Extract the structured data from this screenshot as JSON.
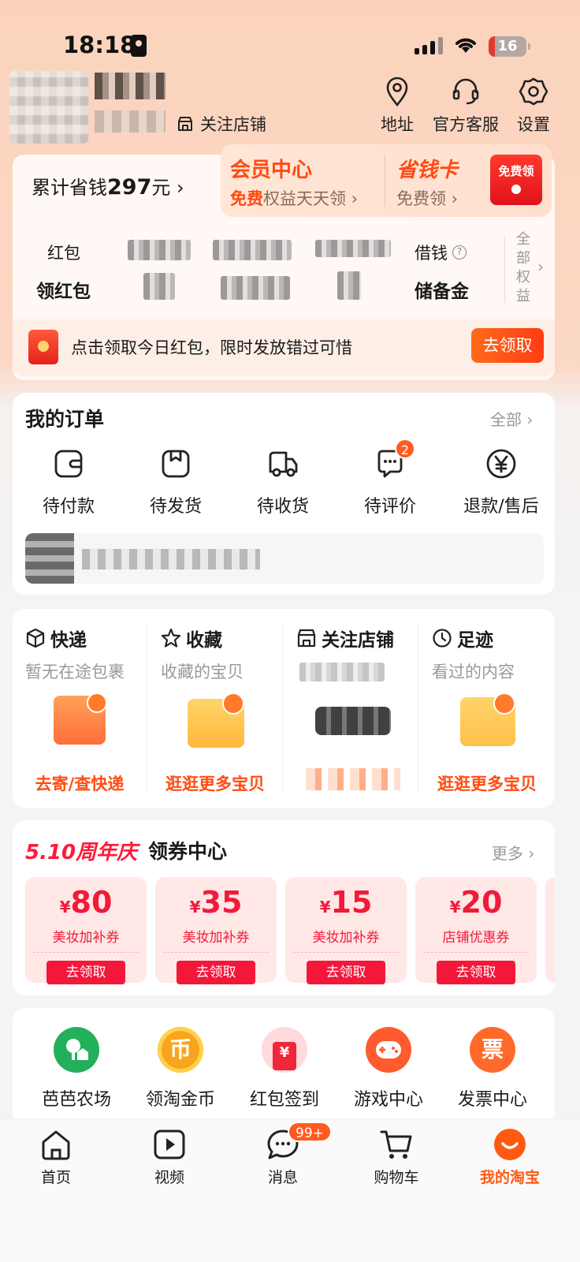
{
  "status_bar": {
    "time": "18:18",
    "battery": "16"
  },
  "profile": {
    "follow_shop": "关注店铺",
    "actions": [
      {
        "label": "地址",
        "icon": "location-pin-icon"
      },
      {
        "label": "官方客服",
        "icon": "headset-icon"
      },
      {
        "label": "设置",
        "icon": "gear-icon"
      }
    ]
  },
  "member": {
    "save_prefix": "累计省钱",
    "save_amount": "297",
    "save_suffix": "元 ›",
    "vip_title": "会员中心",
    "vip_sub_em": "免费",
    "vip_sub_rest": "权益天天领 ›",
    "card_title": "省钱卡",
    "card_sub": "免费领 ›",
    "free_btn": "免费领",
    "row1_label": "红包",
    "row2_label": "领红包",
    "borrow_label": "借钱",
    "reserve_label": "储备金",
    "all_rights": "全部权益",
    "rp_text": "点击领取今日红包，限时发放错过可惜",
    "rp_btn": "去领取"
  },
  "orders": {
    "title": "我的订单",
    "more": "全部 ›",
    "items": [
      {
        "label": "待付款",
        "icon": "wallet-icon"
      },
      {
        "label": "待发货",
        "icon": "package-icon"
      },
      {
        "label": "待收货",
        "icon": "truck-icon"
      },
      {
        "label": "待评价",
        "icon": "comment-icon",
        "badge": "2"
      },
      {
        "label": "退款/售后",
        "icon": "yen-icon"
      }
    ]
  },
  "quick": [
    {
      "title": "快递",
      "sub": "暂无在途包裹",
      "link": "去寄/查快递",
      "icon": "box-icon"
    },
    {
      "title": "收藏",
      "sub": "收藏的宝贝",
      "link": "逛逛更多宝贝",
      "icon": "star-icon"
    },
    {
      "title": "关注店铺",
      "sub": "",
      "link": "",
      "icon": "shop-icon"
    },
    {
      "title": "足迹",
      "sub": "看过的内容",
      "link": "逛逛更多宝贝",
      "icon": "clock-icon"
    }
  ],
  "coupons": {
    "anniv": "5.10周年庆",
    "title": "领券中心",
    "more": "更多 ›",
    "items": [
      {
        "currency": "¥",
        "amount": "80",
        "desc": "美妆加补券",
        "btn": "去领取"
      },
      {
        "currency": "¥",
        "amount": "35",
        "desc": "美妆加补券",
        "btn": "去领取"
      },
      {
        "currency": "¥",
        "amount": "15",
        "desc": "美妆加补券",
        "btn": "去领取"
      },
      {
        "currency": "¥",
        "amount": "20",
        "desc": "店铺优惠券",
        "btn": "去领取"
      }
    ]
  },
  "services": [
    {
      "label": "芭芭农场",
      "glyph": "",
      "color": "#22b05a",
      "icon": "farm-icon"
    },
    {
      "label": "领淘金币",
      "glyph": "币",
      "color": "#f7a51c",
      "icon": "gold-coin-icon"
    },
    {
      "label": "红包签到",
      "glyph": "¥",
      "color": "#f0263a",
      "icon": "red-envelope-icon"
    },
    {
      "label": "游戏中心",
      "glyph": "",
      "color": "#ff5b2e",
      "icon": "gamepad-icon"
    },
    {
      "label": "发票中心",
      "glyph": "票",
      "color": "#ff6a2a",
      "icon": "invoice-icon"
    }
  ],
  "tabs": [
    {
      "label": "首页",
      "icon": "home-icon"
    },
    {
      "label": "视频",
      "icon": "video-icon"
    },
    {
      "label": "消息",
      "icon": "message-icon",
      "badge": "99+"
    },
    {
      "label": "购物车",
      "icon": "cart-icon"
    },
    {
      "label": "我的淘宝",
      "icon": "my-taobao-icon"
    }
  ]
}
